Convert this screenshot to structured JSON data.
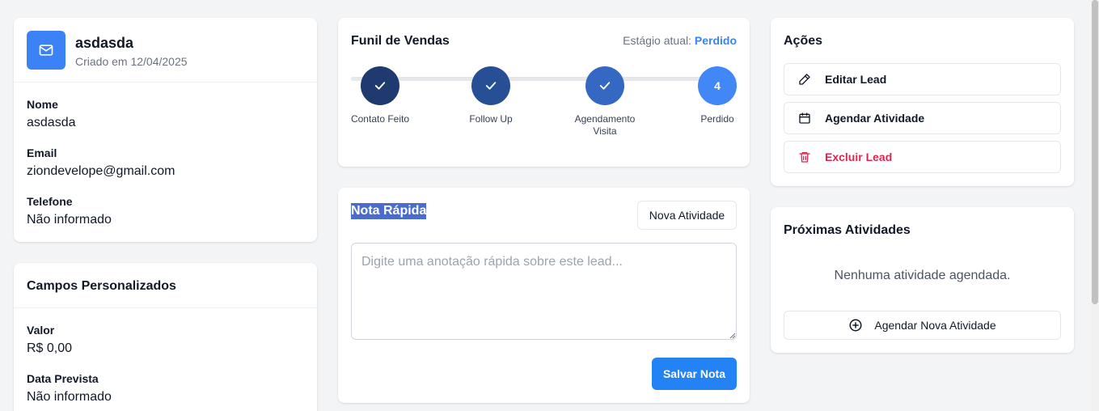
{
  "lead": {
    "name": "asdasda",
    "created": "Criado em 12/04/2025",
    "fields": [
      {
        "label": "Nome",
        "value": "asdasda"
      },
      {
        "label": "Email",
        "value": "ziondevelope@gmail.com"
      },
      {
        "label": "Telefone",
        "value": "Não informado"
      }
    ]
  },
  "custom_fields": {
    "title": "Campos Personalizados",
    "fields": [
      {
        "label": "Valor",
        "value": "R$ 0,00"
      },
      {
        "label": "Data Prevista",
        "value": "Não informado"
      }
    ]
  },
  "funnel": {
    "title": "Funil de Vendas",
    "stage_prefix": "Estágio atual:",
    "stage_current": "Perdido",
    "steps": [
      {
        "label": "Contato Feito",
        "state": "done",
        "color": "#1e3a6e"
      },
      {
        "label": "Follow Up",
        "state": "done",
        "color": "#274f96"
      },
      {
        "label": "Agendamento Visita",
        "state": "done",
        "color": "#3468c2"
      },
      {
        "label": "Perdido",
        "state": "current",
        "number": "4",
        "color": "#4187f5"
      }
    ]
  },
  "note": {
    "title": "Nota Rápida",
    "new_activity_label": "Nova Atividade",
    "placeholder": "Digite uma anotação rápida sobre este lead...",
    "save_label": "Salvar Nota"
  },
  "actions": {
    "title": "Ações",
    "items": [
      {
        "label": "Editar Lead",
        "icon": "pencil-icon"
      },
      {
        "label": "Agendar Atividade",
        "icon": "calendar-icon"
      },
      {
        "label": "Excluir Lead",
        "icon": "trash-icon",
        "danger": true
      }
    ]
  },
  "upcoming": {
    "title": "Próximas Atividades",
    "empty_text": "Nenhuma atividade agendada.",
    "schedule_label": "Agendar Nova Atividade"
  },
  "colors": {
    "primary": "#3b82f6",
    "danger": "#dc2651",
    "note_highlight": "#4a6ccc"
  }
}
